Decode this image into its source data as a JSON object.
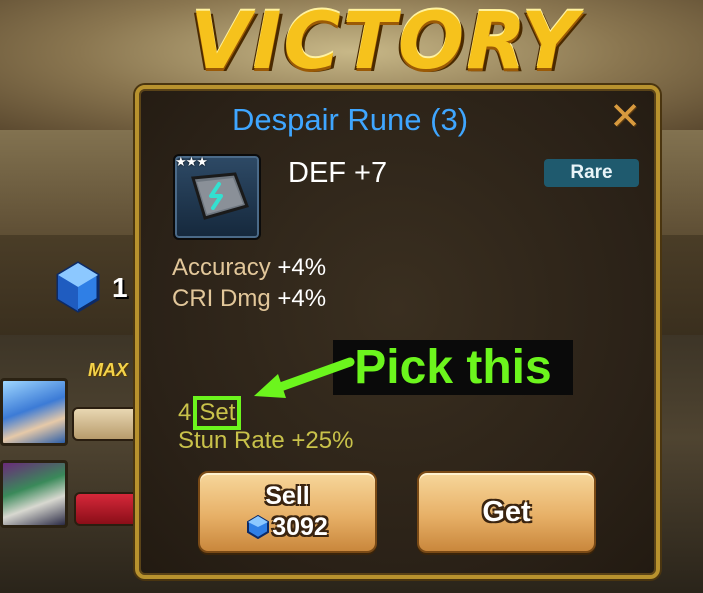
{
  "banner": {
    "title": "VICTORY"
  },
  "background_ui": {
    "crystal_count_partial": "1",
    "max_label": "MAX"
  },
  "rune_popup": {
    "title": "Despair Rune (3)",
    "close_symbol": "✕",
    "stars": "★★★",
    "main_stat": "DEF +7",
    "rarity": "Rare",
    "sub_stats": [
      {
        "name": "Accuracy",
        "value": "+4%"
      },
      {
        "name": "CRI Dmg",
        "value": "+4%"
      }
    ],
    "set_count": "4",
    "set_label": "Set",
    "set_effect": "Stun Rate +25%",
    "sell_label": "Sell",
    "sell_price": "3092",
    "get_label": "Get"
  },
  "annotation": {
    "callout_text": "Pick this",
    "highlight_color": "#6cf51d"
  },
  "colors": {
    "title_blue": "#3fa6ff",
    "victory_gold": "#f6c21c",
    "popup_border": "#b8922e",
    "set_text": "#c9c24a",
    "rarity_badge": "#1f5a6e"
  },
  "icons": {
    "close": "close-icon",
    "rune": "despair-rune-icon",
    "crystal": "crystal-icon"
  }
}
